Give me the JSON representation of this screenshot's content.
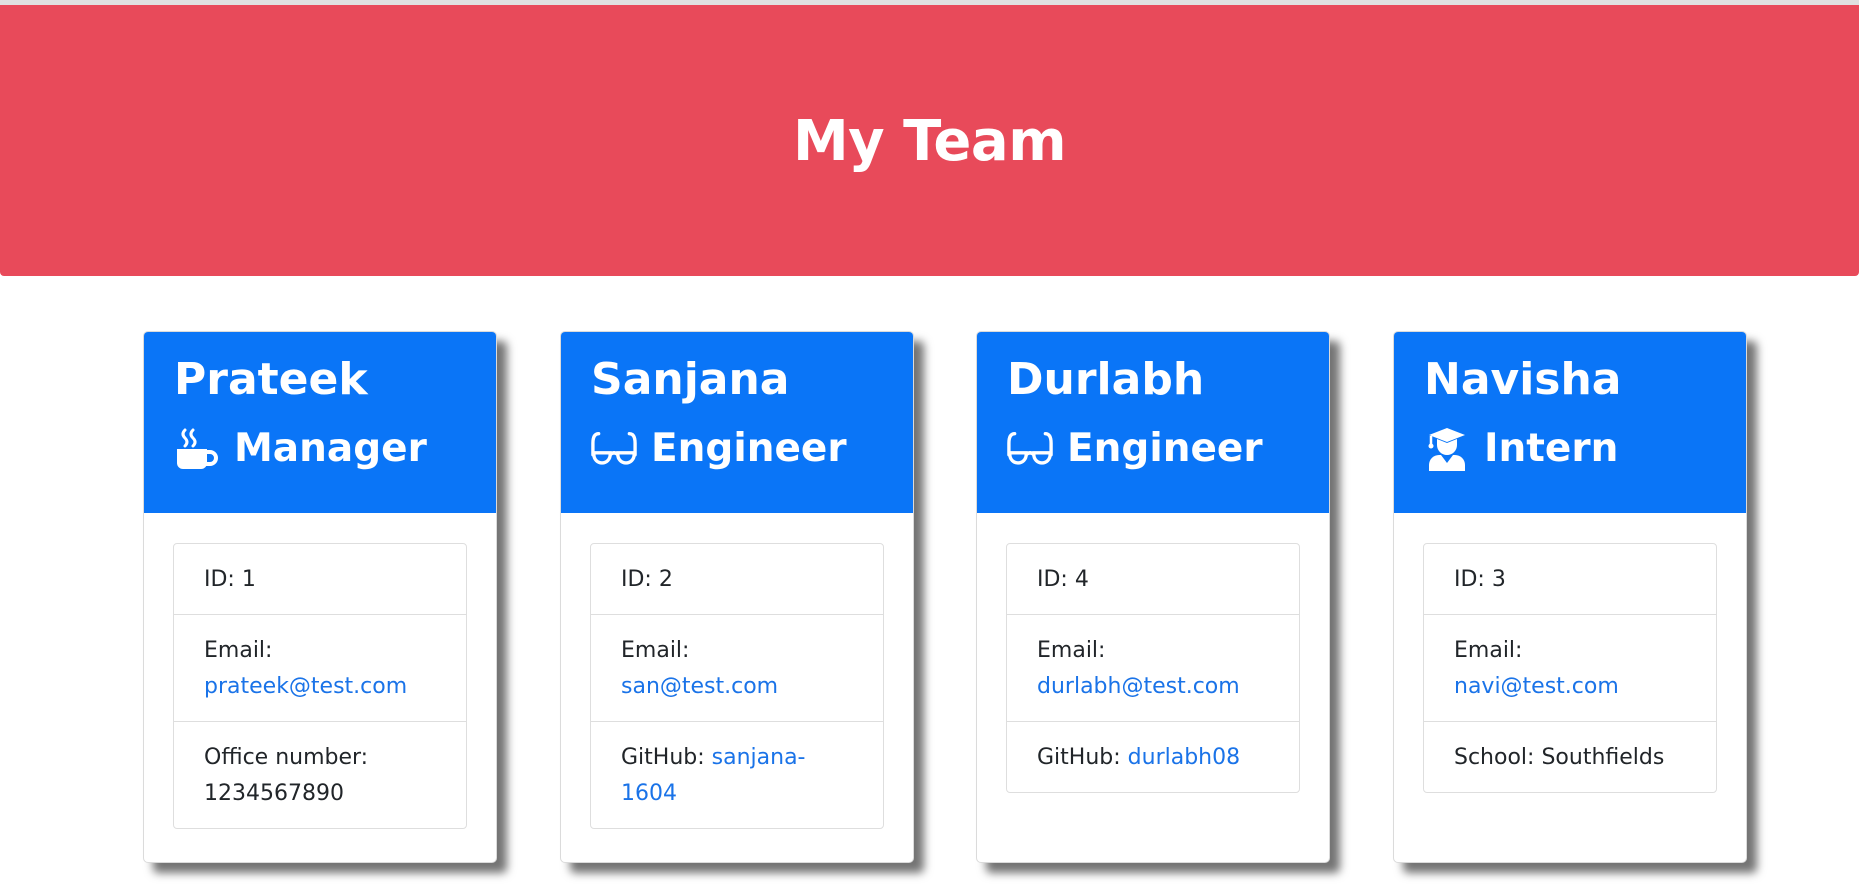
{
  "header": {
    "title": "My Team"
  },
  "colors": {
    "jumbotron": "#e84a5a",
    "card_header": "#0a75f7",
    "link": "#1a73e8"
  },
  "employees": [
    {
      "name": "Prateek",
      "role": "Manager",
      "icon": "mug-hot-icon",
      "id_label": "ID: 1",
      "email_label": "Email:",
      "email": "prateek@test.com",
      "extra_label": "Office number:",
      "extra_value": "1234567890"
    },
    {
      "name": "Sanjana",
      "role": "Engineer",
      "icon": "glasses-icon",
      "id_label": "ID: 2",
      "email_label": "Email:",
      "email": "san@test.com",
      "extra_label": "GitHub:",
      "extra_value": "sanjana-1604"
    },
    {
      "name": "Durlabh",
      "role": "Engineer",
      "icon": "glasses-icon",
      "id_label": "ID: 4",
      "email_label": "Email:",
      "email": "durlabh@test.com",
      "extra_label": "GitHub:",
      "extra_value": "durlabh08"
    },
    {
      "name": "Navisha",
      "role": "Intern",
      "icon": "user-graduate-icon",
      "id_label": "ID: 3",
      "email_label": "Email:",
      "email": "navi@test.com",
      "extra_label": "School:",
      "extra_value": "Southfields"
    }
  ]
}
